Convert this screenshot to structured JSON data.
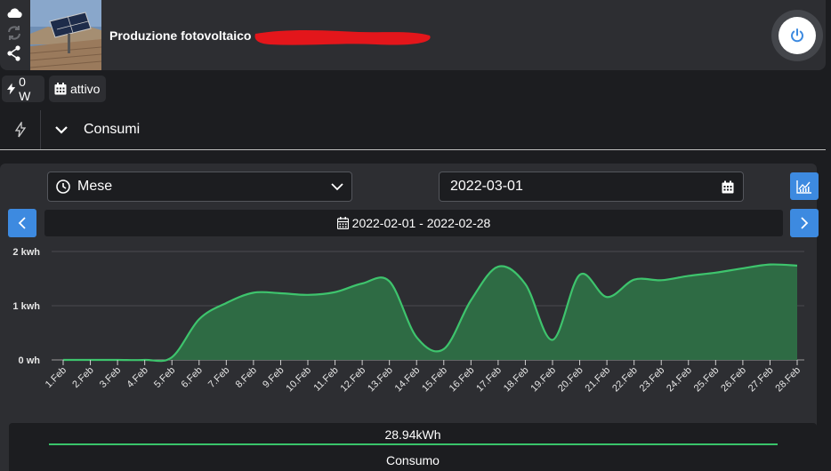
{
  "header": {
    "title": "Produzione fotovoltaico",
    "left_icons": [
      "cloud-icon",
      "refresh-icon",
      "share-icon"
    ],
    "power_icon": "power-icon"
  },
  "badges": {
    "power": "0 W",
    "status": "attivo"
  },
  "section": {
    "title": "Consumi",
    "icon": "bolt-icon"
  },
  "controls": {
    "period_select": "Mese",
    "date_input": "2022-03-01",
    "range": "2022-02-01 - 2022-02-28"
  },
  "chart_data": {
    "type": "area",
    "categories": [
      "1.Feb",
      "2.Feb",
      "3.Feb",
      "4.Feb",
      "5.Feb",
      "6.Feb",
      "7.Feb",
      "8.Feb",
      "9.Feb",
      "10.Feb",
      "11.Feb",
      "12.Feb",
      "13.Feb",
      "14.Feb",
      "15.Feb",
      "16.Feb",
      "17.Feb",
      "18.Feb",
      "19.Feb",
      "20.Feb",
      "21.Feb",
      "22.Feb",
      "23.Feb",
      "24.Feb",
      "25.Feb",
      "26.Feb",
      "27.Feb",
      "28.Feb"
    ],
    "values": [
      0,
      0,
      0,
      0,
      0.05,
      0.75,
      1.05,
      1.24,
      1.23,
      1.2,
      1.25,
      1.41,
      1.45,
      0.42,
      0.2,
      1.1,
      1.72,
      1.4,
      0.37,
      1.57,
      1.16,
      1.48,
      1.47,
      1.55,
      1.61,
      1.69,
      1.76,
      1.74
    ],
    "y_ticks": [
      "2 kwh",
      "1 kwh",
      "0 wh"
    ],
    "ylim": [
      0,
      2
    ],
    "series_name": "Consumo",
    "total": "28.94kWh",
    "line_color": "#3ec46d",
    "fill_color": "#2e6b44"
  }
}
